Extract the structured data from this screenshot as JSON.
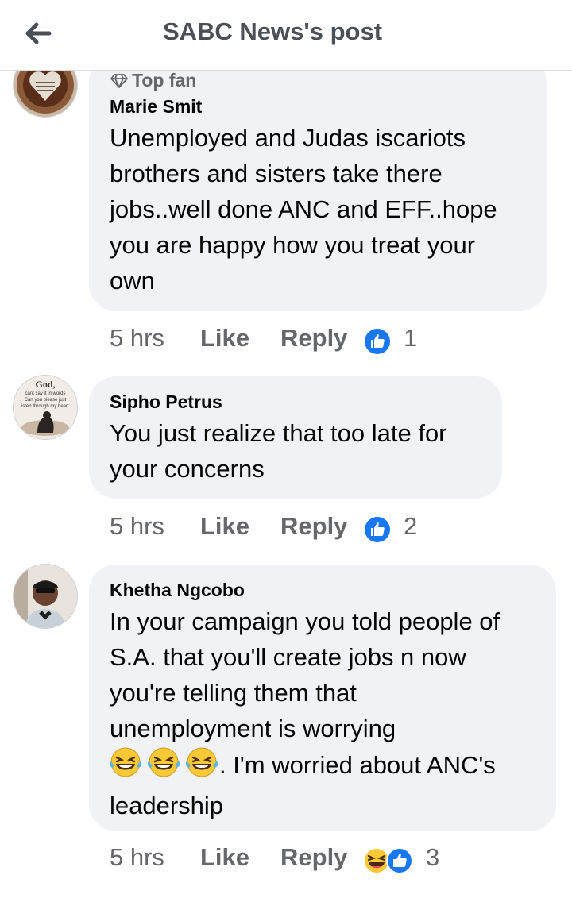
{
  "header": {
    "title": "SABC News's post",
    "back_icon": "arrow-left-icon"
  },
  "comments": [
    {
      "badge": "Top fan",
      "author": "Marie Smit",
      "lines": [
        "Unemployed and Judas iscariots",
        "brothers and sisters take there",
        "jobs..well done ANC and EFF..hope",
        "you are happy how you treat your",
        "own"
      ],
      "time": "5 hrs",
      "like": "Like",
      "reply": "Reply",
      "reaction_count": "1"
    },
    {
      "author": "Sipho Petrus",
      "avatar_text": [
        "God,",
        "cant say it in words",
        "Can you please just",
        "listen through my heart."
      ],
      "lines": [
        "You just realize that too late for",
        "your concerns"
      ],
      "time": "5 hrs",
      "like": "Like",
      "reply": "Reply",
      "reaction_count": "2"
    },
    {
      "author": "Khetha Ngcobo",
      "lines": [
        "In your campaign you told people of",
        "S.A. that you'll create jobs n now",
        "you're telling them that",
        "unemployment is worrying",
        ". I'm worried about ANC's",
        "leadership"
      ],
      "time": "5 hrs",
      "like": "Like",
      "reply": "Reply",
      "reaction_count": "3"
    }
  ],
  "colors": {
    "like_blue": "#1877f2",
    "bubble": "#f0f2f5",
    "meta_text": "#65676b"
  }
}
